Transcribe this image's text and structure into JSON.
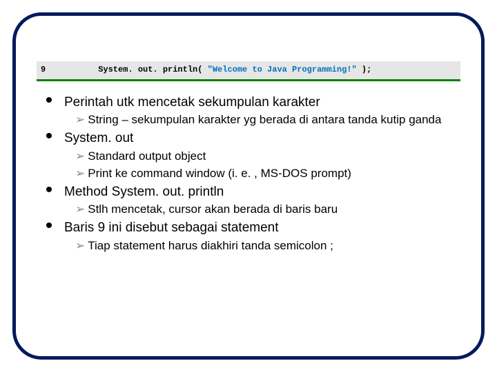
{
  "code": {
    "lineNo": "9",
    "pre": "      System. out. println( ",
    "str": "\"Welcome to Java Programming!\"",
    "post": " );"
  },
  "bullets": [
    {
      "text": "Perintah utk mencetak sekumpulan karakter",
      "subs": [
        "String – sekumpulan karakter yg berada di antara tanda kutip ganda"
      ]
    },
    {
      "text": "System. out",
      "subs": [
        "Standard output object",
        "Print ke command window (i. e. , MS-DOS prompt)"
      ]
    },
    {
      "text": "Method System. out. println",
      "subs": [
        "Stlh mencetak, cursor akan berada di baris baru"
      ]
    },
    {
      "text": "Baris 9 ini disebut sebagai statement",
      "subs": [
        "Tiap statement harus diakhiri tanda semicolon ;"
      ]
    }
  ]
}
